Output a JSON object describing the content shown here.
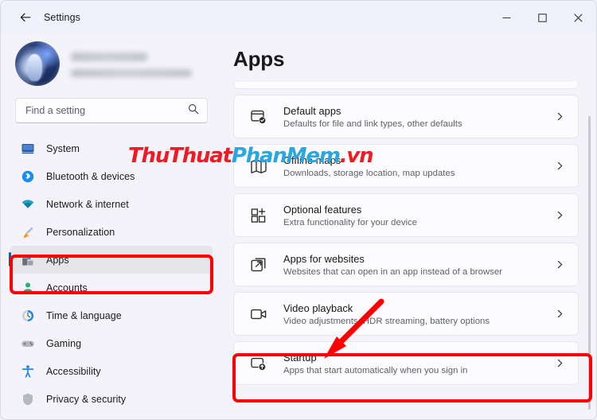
{
  "window": {
    "title": "Settings",
    "back_icon": "back-arrow-icon",
    "controls": {
      "minimize": "minimize-icon",
      "maximize": "maximize-icon",
      "close": "close-icon"
    }
  },
  "sidebar": {
    "account": {
      "name": "",
      "email": "",
      "avatar": "user-avatar"
    },
    "search": {
      "placeholder": "Find a setting",
      "value": "",
      "icon": "search-icon"
    },
    "items": [
      {
        "label": "System",
        "icon": "monitor-icon",
        "selected": false
      },
      {
        "label": "Bluetooth & devices",
        "icon": "bluetooth-icon",
        "selected": false
      },
      {
        "label": "Network & internet",
        "icon": "wifi-icon",
        "selected": false
      },
      {
        "label": "Personalization",
        "icon": "paintbrush-icon",
        "selected": false
      },
      {
        "label": "Apps",
        "icon": "apps-grid-icon",
        "selected": true
      },
      {
        "label": "Accounts",
        "icon": "person-icon",
        "selected": false
      },
      {
        "label": "Time & language",
        "icon": "clock-icon",
        "selected": false
      },
      {
        "label": "Gaming",
        "icon": "gamepad-icon",
        "selected": false
      },
      {
        "label": "Accessibility",
        "icon": "accessibility-icon",
        "selected": false
      },
      {
        "label": "Privacy & security",
        "icon": "shield-icon",
        "selected": false
      }
    ]
  },
  "main": {
    "title": "Apps",
    "cards": [
      {
        "title": "Default apps",
        "subtitle": "Defaults for file and link types, other defaults",
        "icon": "default-apps-icon",
        "chevron": "chevron-right-icon"
      },
      {
        "title": "Offline maps",
        "subtitle": "Downloads, storage location, map updates",
        "icon": "offline-maps-icon",
        "chevron": "chevron-right-icon"
      },
      {
        "title": "Optional features",
        "subtitle": "Extra functionality for your device",
        "icon": "optional-features-icon",
        "chevron": "chevron-right-icon"
      },
      {
        "title": "Apps for websites",
        "subtitle": "Websites that can open in an app instead of a browser",
        "icon": "apps-for-websites-icon",
        "chevron": "chevron-right-icon"
      },
      {
        "title": "Video playback",
        "subtitle": "Video adjustments, HDR streaming, battery options",
        "icon": "video-playback-icon",
        "chevron": "chevron-right-icon"
      },
      {
        "title": "Startup",
        "subtitle": "Apps that start automatically when you sign in",
        "icon": "startup-icon",
        "chevron": "chevron-right-icon"
      }
    ]
  },
  "annotations": {
    "color": "#ff0000",
    "sidebar_highlight_target": "Apps",
    "card_highlight_target": "Startup",
    "arrow": "red-arrow-pointing-to-startup"
  },
  "watermark": {
    "part1": "ThuThuat",
    "part2": "PhanMem",
    "part3": ".vn",
    "color1": "#ed1c24",
    "color2": "#29a7e1"
  },
  "colors": {
    "window_background": "#f3f3f9",
    "card_background": "#fcfcfe",
    "accent": "#0067c0",
    "selected_item": "#e6e6ea"
  }
}
